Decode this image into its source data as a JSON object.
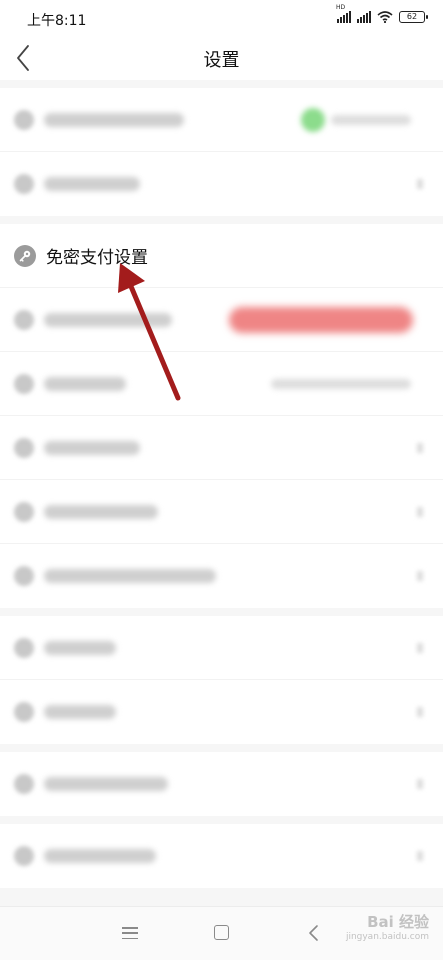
{
  "status_bar": {
    "time": "上午8:11",
    "hd_label": "HD",
    "battery": "62"
  },
  "nav": {
    "title": "设置",
    "back_icon": "chevron-left-icon"
  },
  "focused_item": {
    "label": "免密支付设置",
    "icon": "key-icon"
  },
  "annotation": {
    "arrow_color": "#a31c1c"
  },
  "colors": {
    "highlight_red": "#ef8585",
    "toggle_green": "#8cdc8c"
  },
  "bottom_nav": {
    "watermark_main": "Bai 经验",
    "watermark_sub": "jingyan.baidu.com"
  }
}
